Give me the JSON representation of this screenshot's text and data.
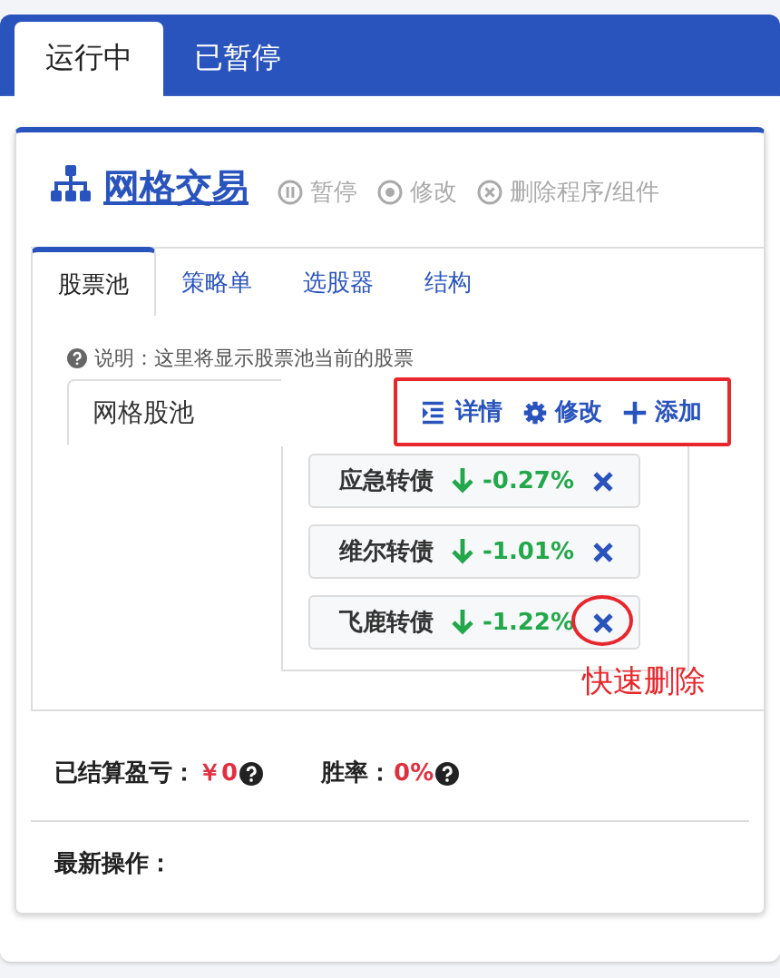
{
  "tabs": [
    {
      "label": "运行中",
      "selected": true
    },
    {
      "label": "已暂停",
      "selected": false
    }
  ],
  "program": {
    "title": "网格交易",
    "actions": [
      {
        "kind": "pause",
        "label": "暂停"
      },
      {
        "kind": "edit",
        "label": "修改"
      },
      {
        "kind": "delete",
        "label": "删除程序/组件"
      }
    ]
  },
  "subtabs": [
    {
      "label": "股票池",
      "selected": true
    },
    {
      "label": "策略单",
      "selected": false
    },
    {
      "label": "选股器",
      "selected": false
    },
    {
      "label": "结构",
      "selected": false
    }
  ],
  "pool": {
    "note": "说明：这里将显示股票池当前的股票",
    "name": "网格股池",
    "buttons": [
      {
        "kind": "details",
        "label": "详情"
      },
      {
        "kind": "settings",
        "label": "修改"
      },
      {
        "kind": "add",
        "label": "添加"
      }
    ],
    "stocks": [
      {
        "name": "应急转债",
        "change": "-0.27%",
        "falling": true
      },
      {
        "name": "维尔转债",
        "change": "-1.01%",
        "falling": true
      },
      {
        "name": "飞鹿转债",
        "change": "-1.22%",
        "falling": true,
        "highlighted": true
      }
    ],
    "annotation": "快速删除"
  },
  "stats": [
    {
      "label": "已结算盈亏：",
      "value": "￥0"
    },
    {
      "label": "胜率：",
      "value": "0%"
    }
  ],
  "latest": {
    "label": "最新操作："
  }
}
